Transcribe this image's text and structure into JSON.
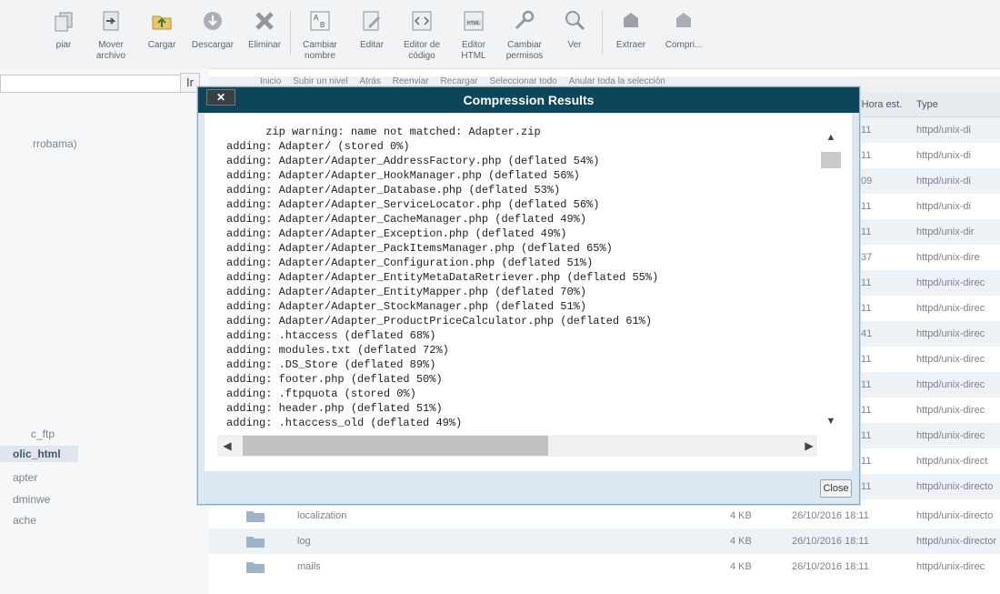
{
  "toolbar": {
    "buttons": [
      {
        "label": "piar",
        "icon": "copy-icon"
      },
      {
        "label": "Mover archivo",
        "icon": "move-file-icon"
      },
      {
        "label": "Cargar",
        "icon": "upload-icon"
      },
      {
        "label": "Descargar",
        "icon": "download-icon"
      },
      {
        "label": "Eliminar",
        "icon": "delete-icon"
      },
      {
        "label": "Cambiar nombre",
        "icon": "rename-icon"
      },
      {
        "label": "Editar",
        "icon": "edit-icon"
      },
      {
        "label": "Editor de código",
        "icon": "code-editor-icon"
      },
      {
        "label": "Editor HTML",
        "icon": "html-editor-icon"
      },
      {
        "label": "Cambiar permisos",
        "icon": "permissions-icon"
      },
      {
        "label": "Ver",
        "icon": "view-icon"
      },
      {
        "label": "Extraer",
        "icon": "extract-icon"
      },
      {
        "label": "Compri...",
        "icon": "compress-icon"
      }
    ]
  },
  "navbar": {
    "go_label": "Ir",
    "items": [
      "Inicio",
      "Subir un nivel",
      "Atrás",
      "Reenviar",
      "Recargar",
      "Seleccionar todo",
      "Anular toda la selección"
    ]
  },
  "sidebar": {
    "items": [
      "rrobama)",
      "c_ftp",
      "olic_html",
      "apter",
      "dminwe",
      "ache"
    ]
  },
  "table": {
    "headers": {
      "time": "(Hora est.",
      "type": "Type"
    },
    "rows_behind": [
      {
        "time": ":11",
        "type": "httpd/unix-di"
      },
      {
        "time": ":11",
        "type": "httpd/unix-di"
      },
      {
        "time": ":09",
        "type": "httpd/unix-di"
      },
      {
        "time": ":11",
        "type": "httpd/unix-di"
      },
      {
        "time": ":11",
        "type": "httpd/unix-dir"
      },
      {
        "time": ":37",
        "type": "httpd/unix-dire"
      },
      {
        "time": ":11",
        "type": "httpd/unix-direc"
      },
      {
        "time": ":11",
        "type": "httpd/unix-direc"
      },
      {
        "time": ":41",
        "type": "httpd/unix-direc"
      },
      {
        "time": ":11",
        "type": "httpd/unix-direc"
      },
      {
        "time": ":11",
        "type": "httpd/unix-direc"
      },
      {
        "time": ":11",
        "type": "httpd/unix-direc"
      },
      {
        "time": ":11",
        "type": "httpd/unix-direc"
      },
      {
        "time": ":11",
        "type": "httpd/unix-direct"
      },
      {
        "time": ":11",
        "type": "httpd/unix-directo"
      }
    ],
    "rows_visible": [
      {
        "name": "localization",
        "size": "4 KB",
        "date": "26/10/2016 18:11",
        "type": "httpd/unix-directo"
      },
      {
        "name": "log",
        "size": "4 KB",
        "date": "26/10/2016 18:11",
        "type": "httpd/unix-director"
      },
      {
        "name": "mails",
        "size": "4 KB",
        "date": "26/10/2016 18:11",
        "type": "httpd/unix-direc"
      }
    ]
  },
  "dialog": {
    "title": "Compression Results",
    "close_x": "✕",
    "close_button": "Close",
    "output_lines": [
      "      zip warning: name not matched: Adapter.zip",
      "adding: Adapter/ (stored 0%)",
      "adding: Adapter/Adapter_AddressFactory.php (deflated 54%)",
      "adding: Adapter/Adapter_HookManager.php (deflated 56%)",
      "adding: Adapter/Adapter_Database.php (deflated 53%)",
      "adding: Adapter/Adapter_ServiceLocator.php (deflated 56%)",
      "adding: Adapter/Adapter_CacheManager.php (deflated 49%)",
      "adding: Adapter/Adapter_Exception.php (deflated 49%)",
      "adding: Adapter/Adapter_PackItemsManager.php (deflated 65%)",
      "adding: Adapter/Adapter_Configuration.php (deflated 51%)",
      "adding: Adapter/Adapter_EntityMetaDataRetriever.php (deflated 55%)",
      "adding: Adapter/Adapter_EntityMapper.php (deflated 70%)",
      "adding: Adapter/Adapter_StockManager.php (deflated 51%)",
      "adding: Adapter/Adapter_ProductPriceCalculator.php (deflated 61%)",
      "adding: .htaccess (deflated 68%)",
      "adding: modules.txt (deflated 72%)",
      "adding: .DS_Store (deflated 89%)",
      "adding: footer.php (deflated 50%)",
      "adding: .ftpquota (stored 0%)",
      "adding: header.php (deflated 51%)",
      "adding: .htaccess_old (deflated 49%)"
    ]
  },
  "colors": {
    "dialog_title_bg": "#0d4658",
    "dialog_frame": "#d9e8f3",
    "row_alt": "#edf2f7"
  }
}
